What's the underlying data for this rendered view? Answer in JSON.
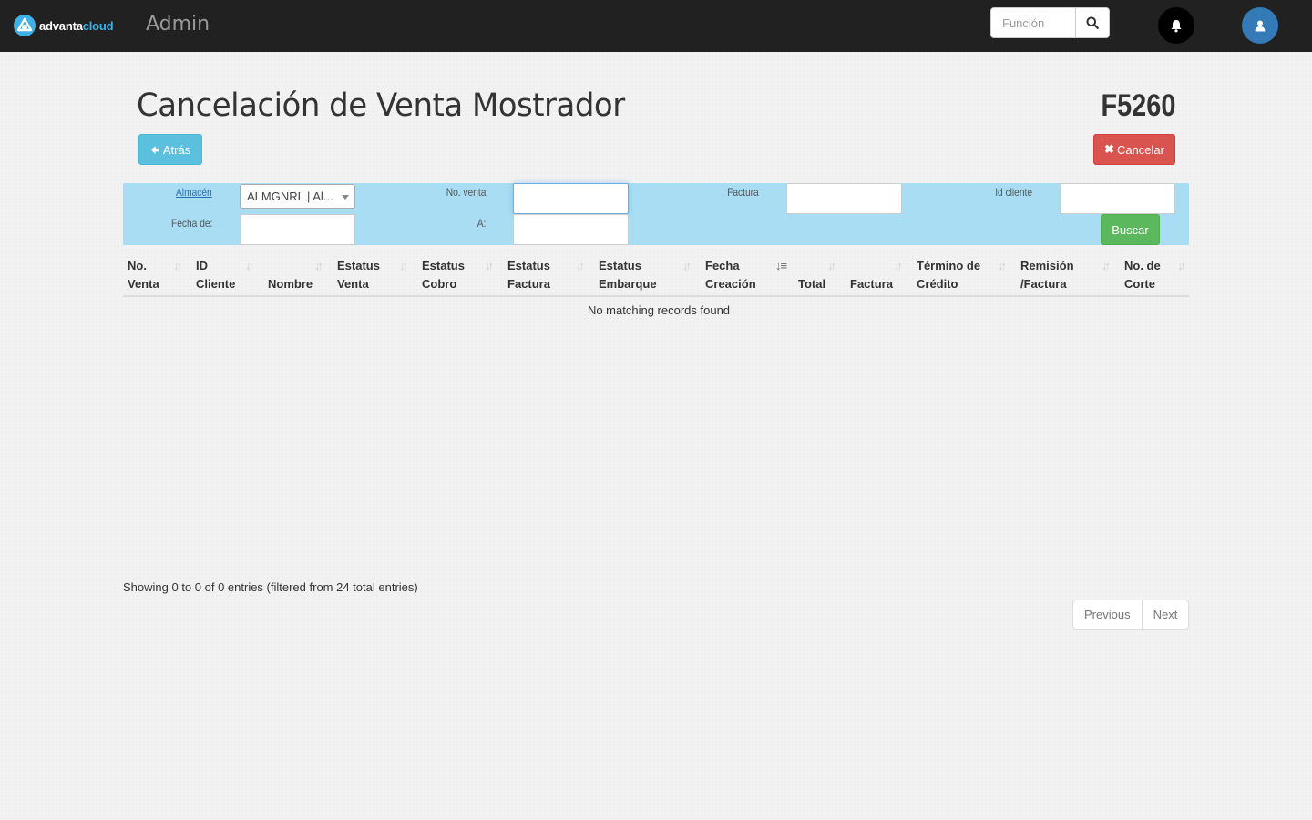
{
  "navbar": {
    "logo_part1": "advanta",
    "logo_part2": "cloud",
    "section": "Admin",
    "search_placeholder": "Función",
    "search_icon": "search-icon",
    "bell_icon": "bell-icon",
    "user_icon": "user-icon"
  },
  "page": {
    "title": "Cancelación de Venta Mostrador",
    "code": "F5260",
    "back_label": "Atrás",
    "cancel_label": "Cancelar"
  },
  "filters": {
    "almacen_label": "Almacén",
    "almacen_value": "ALMGNRL | Al...",
    "fecha_de_label": "Fecha de:",
    "fecha_de_value": "",
    "no_venta_label": "No. venta",
    "no_venta_value": "",
    "a_label": "A:",
    "a_value": "",
    "factura_label": "Factura",
    "factura_value": "",
    "id_cliente_label": "Id cliente",
    "id_cliente_value": "",
    "buscar_label": "Buscar"
  },
  "table": {
    "columns": [
      {
        "line1": "No.",
        "line2": "Venta"
      },
      {
        "line1": "ID",
        "line2": "Cliente"
      },
      {
        "line1": "",
        "line2": "Nombre"
      },
      {
        "line1": "Estatus",
        "line2": "Venta"
      },
      {
        "line1": "Estatus",
        "line2": "Cobro"
      },
      {
        "line1": "Estatus",
        "line2": "Factura"
      },
      {
        "line1": "Estatus",
        "line2": "Embarque"
      },
      {
        "line1": "Fecha",
        "line2": "Creación"
      },
      {
        "line1": "",
        "line2": "Total"
      },
      {
        "line1": "",
        "line2": "Factura"
      },
      {
        "line1": "Término de",
        "line2": "Crédito"
      },
      {
        "line1": "Remisión",
        "line2": "/Factura"
      },
      {
        "line1": "No. de",
        "line2": "Corte"
      }
    ],
    "sorted_column": "Fecha Creación",
    "empty_message": "No matching records found",
    "info": "Showing 0 to 0 of 0 entries (filtered from 24 total entries)",
    "previous_label": "Previous",
    "next_label": "Next"
  },
  "colors": {
    "navbar": "#212121",
    "filter_panel": "#a8ddf4",
    "info_button": "#5bc0de",
    "danger_button": "#d9534f",
    "success_button": "#5cb85c",
    "user_avatar": "#337ab7"
  }
}
